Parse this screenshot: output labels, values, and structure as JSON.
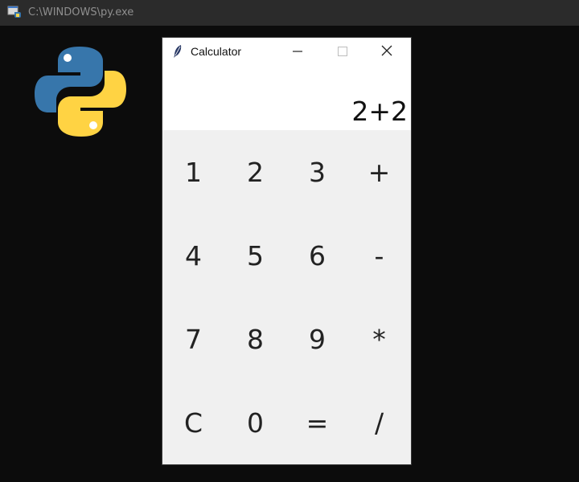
{
  "console": {
    "title": "C:\\WINDOWS\\py.exe",
    "icon": "python-console-icon"
  },
  "desktop": {
    "logo": "python-logo"
  },
  "calculator": {
    "title": "Calculator",
    "app_icon": "feather-icon",
    "controls": {
      "minimize": "minimize-icon",
      "maximize": "maximize-icon",
      "close": "close-icon"
    },
    "display": "2+2",
    "keys": [
      [
        "1",
        "2",
        "3",
        "+"
      ],
      [
        "4",
        "5",
        "6",
        "-"
      ],
      [
        "7",
        "8",
        "9",
        "*"
      ],
      [
        "C",
        "0",
        "=",
        "/"
      ]
    ]
  },
  "colors": {
    "console_bg": "#0c0c0c",
    "console_titlebar": "#2b2b2b",
    "window_bg": "#f0f0f0",
    "display_bg": "#ffffff",
    "python_blue": "#3776ab",
    "python_yellow": "#ffd343"
  }
}
